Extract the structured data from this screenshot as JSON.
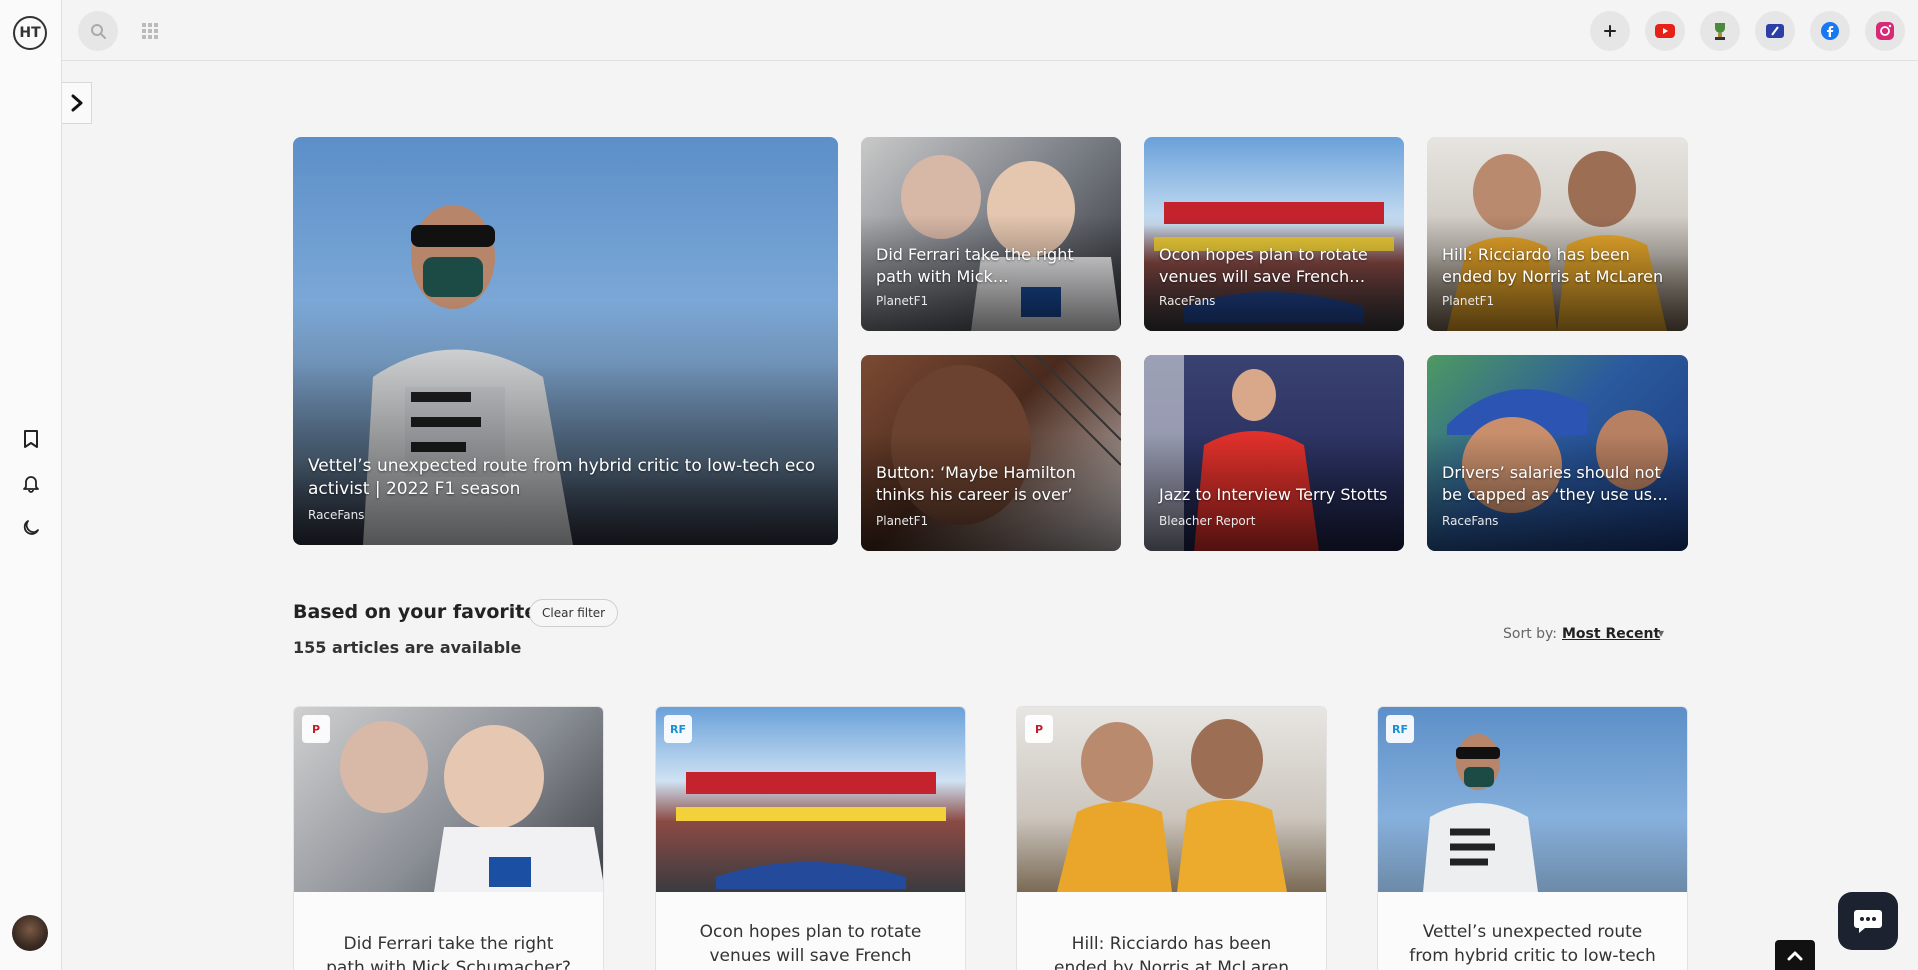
{
  "app": {
    "logo_text": "HT"
  },
  "featured": [
    {
      "title": "Vettel’s unexpected route from hybrid critic to low-tech eco activist | 2022 F1 season",
      "source": "RaceFans"
    },
    {
      "title": "Did Ferrari take the right path with Mick…",
      "source": "PlanetF1"
    },
    {
      "title": "Ocon hopes plan to rotate venues will save French…",
      "source": "RaceFans"
    },
    {
      "title": "Hill: Ricciardo has been ended by Norris at McLaren",
      "source": "PlanetF1"
    },
    {
      "title": "Button: ‘Maybe Hamilton thinks his career is over’",
      "source": "PlanetF1"
    },
    {
      "title": "Jazz to Interview Terry Stotts",
      "source": "Bleacher Report"
    },
    {
      "title": "Drivers’ salaries should not be capped as ‘they use us…",
      "source": "RaceFans"
    }
  ],
  "section": {
    "title": "Based on your favorites",
    "clear_filter": "Clear filter",
    "count_text": "155 articles are available",
    "sort_label": "Sort by:",
    "sort_value": "Most Recent"
  },
  "cards": [
    {
      "badge": "P",
      "title_lines": [
        "Did Ferrari take the right",
        "path with Mick Schumacher?"
      ]
    },
    {
      "badge": "RF",
      "title_lines": [
        "Ocon hopes plan to rotate",
        "venues will save French"
      ]
    },
    {
      "badge": "P",
      "title_lines": [
        "Hill: Ricciardo has been",
        "ended by Norris at McLaren"
      ]
    },
    {
      "badge": "RF",
      "title_lines": [
        "Vettel’s unexpected route",
        "from hybrid critic to low-tech"
      ]
    }
  ],
  "colors": {
    "youtube": "#e62117",
    "facebook": "#1877f2",
    "instagram": "#d62976",
    "chat": "#1d2230"
  }
}
